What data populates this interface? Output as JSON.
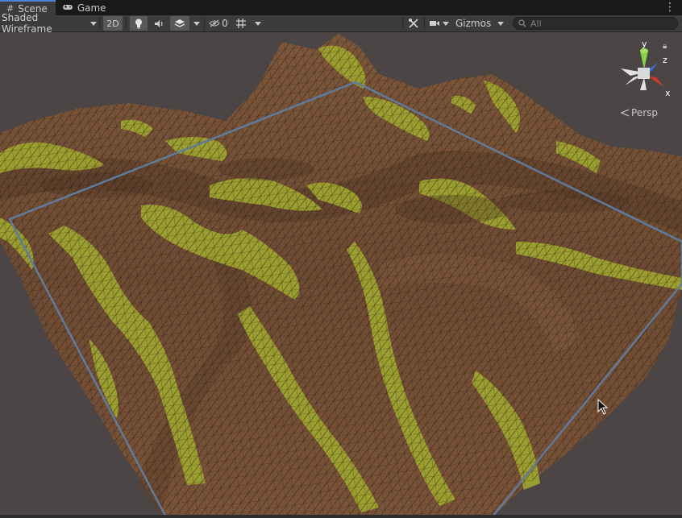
{
  "tabs": [
    {
      "label": "Scene",
      "icon": "hash-grid-icon",
      "active": true
    },
    {
      "label": "Game",
      "icon": "gamepad-icon",
      "active": false
    }
  ],
  "tab_menu_icon": "kebab-menu-icon",
  "toolbar": {
    "draw_mode": "Shaded Wireframe",
    "mode_2d": "2D",
    "hidden_count": "0",
    "gizmos": "Gizmos",
    "search_placeholder": "All"
  },
  "viewport": {
    "projection": "Persp",
    "axes": {
      "y": "y",
      "z": "z",
      "x": "x"
    },
    "colors": {
      "terrain_brown": "#6e4b33",
      "grass_yellow": "#9fa530",
      "bounds_outline": "#5f7b9c",
      "wire": "#1d140c",
      "gizmo_y": "#8ad14a",
      "gizmo_z": "#3d6fe0",
      "gizmo_x": "#d23b2b"
    }
  }
}
